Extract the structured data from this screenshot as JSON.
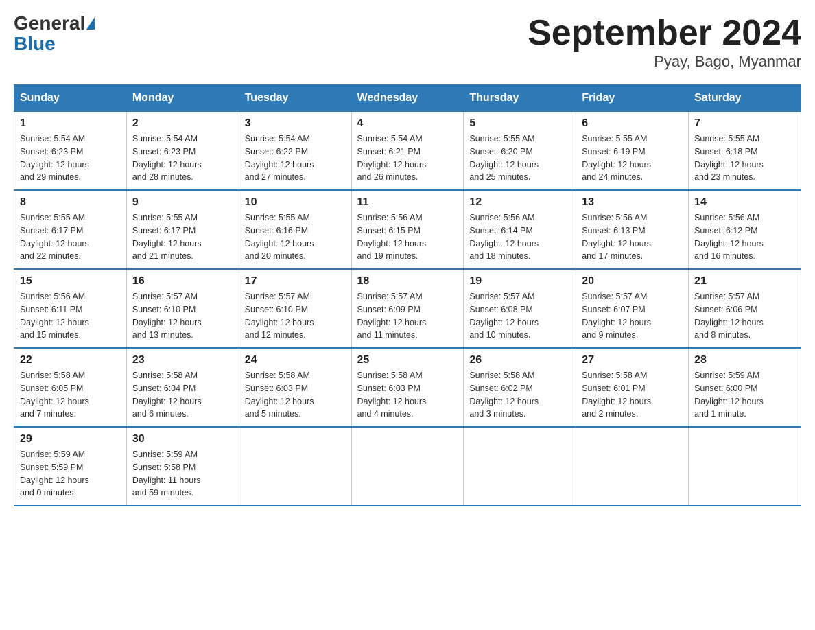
{
  "header": {
    "logo_general": "General",
    "logo_blue": "Blue",
    "title": "September 2024",
    "subtitle": "Pyay, Bago, Myanmar"
  },
  "days_of_week": [
    "Sunday",
    "Monday",
    "Tuesday",
    "Wednesday",
    "Thursday",
    "Friday",
    "Saturday"
  ],
  "weeks": [
    [
      {
        "day": "1",
        "sunrise": "5:54 AM",
        "sunset": "6:23 PM",
        "daylight": "12 hours and 29 minutes."
      },
      {
        "day": "2",
        "sunrise": "5:54 AM",
        "sunset": "6:23 PM",
        "daylight": "12 hours and 28 minutes."
      },
      {
        "day": "3",
        "sunrise": "5:54 AM",
        "sunset": "6:22 PM",
        "daylight": "12 hours and 27 minutes."
      },
      {
        "day": "4",
        "sunrise": "5:54 AM",
        "sunset": "6:21 PM",
        "daylight": "12 hours and 26 minutes."
      },
      {
        "day": "5",
        "sunrise": "5:55 AM",
        "sunset": "6:20 PM",
        "daylight": "12 hours and 25 minutes."
      },
      {
        "day": "6",
        "sunrise": "5:55 AM",
        "sunset": "6:19 PM",
        "daylight": "12 hours and 24 minutes."
      },
      {
        "day": "7",
        "sunrise": "5:55 AM",
        "sunset": "6:18 PM",
        "daylight": "12 hours and 23 minutes."
      }
    ],
    [
      {
        "day": "8",
        "sunrise": "5:55 AM",
        "sunset": "6:17 PM",
        "daylight": "12 hours and 22 minutes."
      },
      {
        "day": "9",
        "sunrise": "5:55 AM",
        "sunset": "6:17 PM",
        "daylight": "12 hours and 21 minutes."
      },
      {
        "day": "10",
        "sunrise": "5:55 AM",
        "sunset": "6:16 PM",
        "daylight": "12 hours and 20 minutes."
      },
      {
        "day": "11",
        "sunrise": "5:56 AM",
        "sunset": "6:15 PM",
        "daylight": "12 hours and 19 minutes."
      },
      {
        "day": "12",
        "sunrise": "5:56 AM",
        "sunset": "6:14 PM",
        "daylight": "12 hours and 18 minutes."
      },
      {
        "day": "13",
        "sunrise": "5:56 AM",
        "sunset": "6:13 PM",
        "daylight": "12 hours and 17 minutes."
      },
      {
        "day": "14",
        "sunrise": "5:56 AM",
        "sunset": "6:12 PM",
        "daylight": "12 hours and 16 minutes."
      }
    ],
    [
      {
        "day": "15",
        "sunrise": "5:56 AM",
        "sunset": "6:11 PM",
        "daylight": "12 hours and 15 minutes."
      },
      {
        "day": "16",
        "sunrise": "5:57 AM",
        "sunset": "6:10 PM",
        "daylight": "12 hours and 13 minutes."
      },
      {
        "day": "17",
        "sunrise": "5:57 AM",
        "sunset": "6:10 PM",
        "daylight": "12 hours and 12 minutes."
      },
      {
        "day": "18",
        "sunrise": "5:57 AM",
        "sunset": "6:09 PM",
        "daylight": "12 hours and 11 minutes."
      },
      {
        "day": "19",
        "sunrise": "5:57 AM",
        "sunset": "6:08 PM",
        "daylight": "12 hours and 10 minutes."
      },
      {
        "day": "20",
        "sunrise": "5:57 AM",
        "sunset": "6:07 PM",
        "daylight": "12 hours and 9 minutes."
      },
      {
        "day": "21",
        "sunrise": "5:57 AM",
        "sunset": "6:06 PM",
        "daylight": "12 hours and 8 minutes."
      }
    ],
    [
      {
        "day": "22",
        "sunrise": "5:58 AM",
        "sunset": "6:05 PM",
        "daylight": "12 hours and 7 minutes."
      },
      {
        "day": "23",
        "sunrise": "5:58 AM",
        "sunset": "6:04 PM",
        "daylight": "12 hours and 6 minutes."
      },
      {
        "day": "24",
        "sunrise": "5:58 AM",
        "sunset": "6:03 PM",
        "daylight": "12 hours and 5 minutes."
      },
      {
        "day": "25",
        "sunrise": "5:58 AM",
        "sunset": "6:03 PM",
        "daylight": "12 hours and 4 minutes."
      },
      {
        "day": "26",
        "sunrise": "5:58 AM",
        "sunset": "6:02 PM",
        "daylight": "12 hours and 3 minutes."
      },
      {
        "day": "27",
        "sunrise": "5:58 AM",
        "sunset": "6:01 PM",
        "daylight": "12 hours and 2 minutes."
      },
      {
        "day": "28",
        "sunrise": "5:59 AM",
        "sunset": "6:00 PM",
        "daylight": "12 hours and 1 minute."
      }
    ],
    [
      {
        "day": "29",
        "sunrise": "5:59 AM",
        "sunset": "5:59 PM",
        "daylight": "12 hours and 0 minutes."
      },
      {
        "day": "30",
        "sunrise": "5:59 AM",
        "sunset": "5:58 PM",
        "daylight": "11 hours and 59 minutes."
      },
      null,
      null,
      null,
      null,
      null
    ]
  ],
  "labels": {
    "sunrise": "Sunrise:",
    "sunset": "Sunset:",
    "daylight": "Daylight:"
  }
}
